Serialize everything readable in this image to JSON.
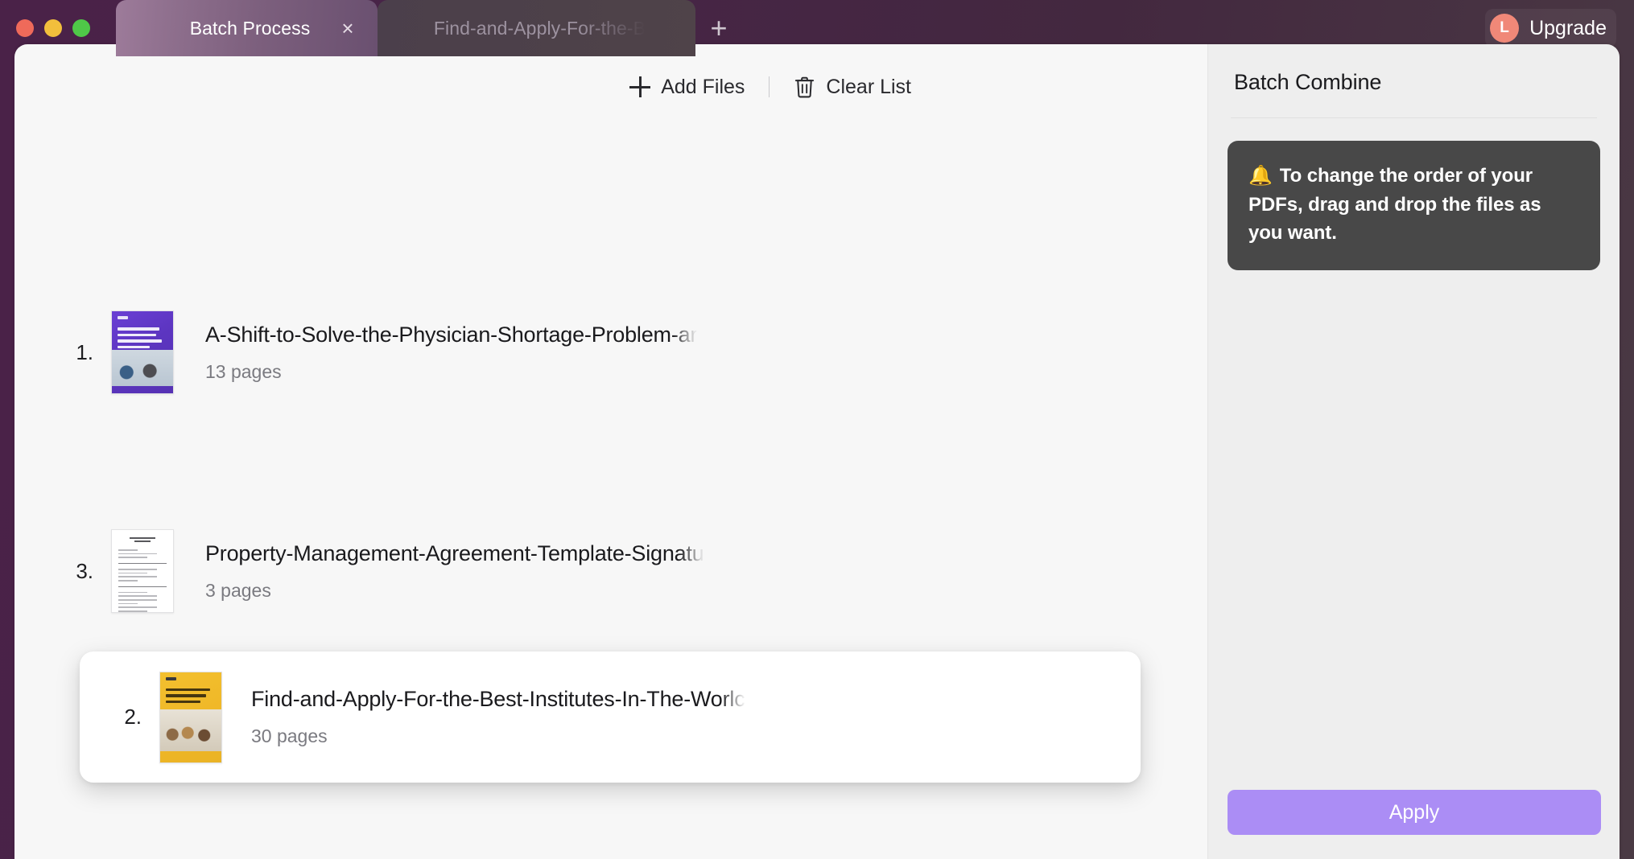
{
  "window": {
    "traffic_lights": [
      "close",
      "minimize",
      "maximize"
    ],
    "colors": {
      "titlebar_purple": "#4a2248",
      "active_tab": "#8e6f8d",
      "accent_purple": "#ab8df5",
      "avatar_coral": "#f08878",
      "tip_box_dark": "#484848"
    }
  },
  "tabs": [
    {
      "label": "Batch Process",
      "active": true,
      "close_icon": "×"
    },
    {
      "label": "Find-and-Apply-For-the-B",
      "active": false
    }
  ],
  "new_tab_label": "+",
  "upgrade": {
    "avatar_initial": "L",
    "label": "Upgrade"
  },
  "toolbar": {
    "add_files_label": "Add Files",
    "clear_list_label": "Clear List"
  },
  "files": [
    {
      "index": "1.",
      "title": "A-Shift-to-Solve-the-Physician-Shortage-Problem-ar",
      "pages": "13 pages",
      "thumb": "purple-cover"
    },
    {
      "index": "3.",
      "title": "Property-Management-Agreement-Template-Signatur",
      "pages": "3 pages",
      "thumb": "document-page"
    }
  ],
  "dragging_file": {
    "index": "2.",
    "title": "Find-and-Apply-For-the-Best-Institutes-In-The-Worlc",
    "pages": "30 pages",
    "thumb": "yellow-cover"
  },
  "side_panel": {
    "title": "Batch Combine",
    "tip_emoji": "🔔",
    "tip_text": "To change the order of your PDFs, drag and drop the files as you want.",
    "apply_label": "Apply"
  }
}
